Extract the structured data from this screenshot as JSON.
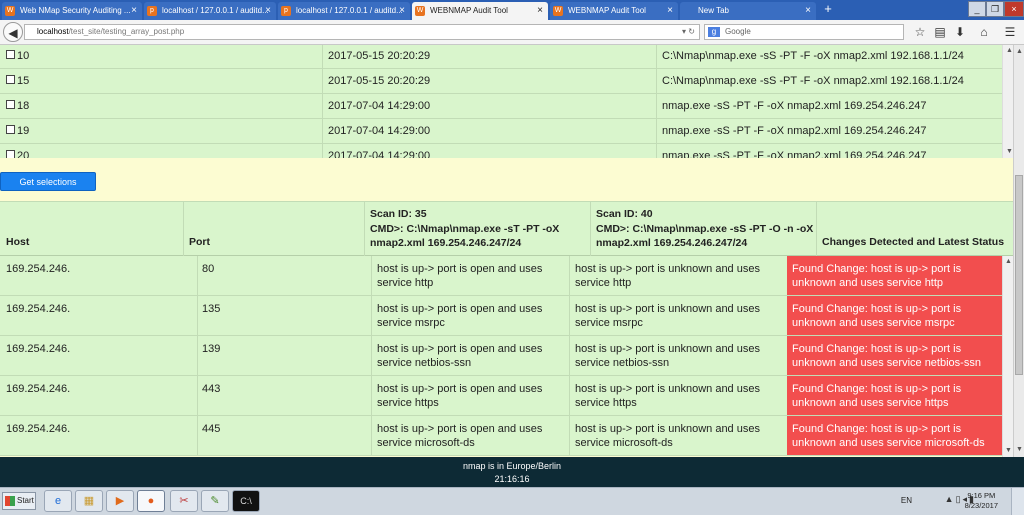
{
  "browser": {
    "tabs": [
      {
        "title": "Web NMap Security Auditing ...",
        "active": false
      },
      {
        "title": "localhost / 127.0.0.1 / auditd...",
        "active": false
      },
      {
        "title": "localhost / 127.0.0.1 / auditd...",
        "active": false
      },
      {
        "title": "WEBNMAP Audit Tool",
        "active": true
      },
      {
        "title": "WEBNMAP Audit Tool",
        "active": false
      },
      {
        "title": "New Tab",
        "active": false
      }
    ],
    "url_host": "localhost",
    "url_path": "/test_site/testing_array_post.php",
    "search_placeholder": "Google"
  },
  "scan_list": {
    "rows": [
      {
        "id": "10",
        "date": "2017-05-15 20:20:29",
        "cmd": "C:\\Nmap\\nmap.exe -sS -PT -F -oX nmap2.xml 192.168.1.1/24"
      },
      {
        "id": "15",
        "date": "2017-05-15 20:20:29",
        "cmd": "C:\\Nmap\\nmap.exe -sS -PT -F -oX nmap2.xml 192.168.1.1/24"
      },
      {
        "id": "18",
        "date": "2017-07-04 14:29:00",
        "cmd": "nmap.exe -sS -PT -F -oX nmap2.xml 169.254.246.247"
      },
      {
        "id": "19",
        "date": "2017-07-04 14:29:00",
        "cmd": "nmap.exe -sS -PT -F -oX nmap2.xml 169.254.246.247"
      },
      {
        "id": "20",
        "date": "2017-07-04 14:29:00",
        "cmd": "nmap.exe -sS -PT -F -oX nmap2.xml 169.254.246.247"
      }
    ],
    "get_selections_label": "Get selections"
  },
  "comparison": {
    "headers": {
      "host": "Host",
      "port": "Port",
      "scan1_id": "Scan ID: 35",
      "scan1_cmd": "CMD>: C:\\Nmap\\nmap.exe -sT -PT -oX nmap2.xml 169.254.246.247/24",
      "scan2_id": "Scan ID: 40",
      "scan2_cmd": "CMD>: C:\\Nmap\\nmap.exe -sS -PT -O -n -oX nmap2.xml 169.254.246.247/24",
      "changes": "Changes Detected and Latest Status"
    },
    "rows": [
      {
        "host": "169.254.246.",
        "port": "80",
        "scan1": "host is up-> port is open and uses service http",
        "scan2": "host is up-> port is unknown and uses service http",
        "change": "Found Change: host is up-> port is unknown and uses service http"
      },
      {
        "host": "169.254.246.",
        "port": "135",
        "scan1": "host is up-> port is open and uses service msrpc",
        "scan2": "host is up-> port is unknown and uses service msrpc",
        "change": "Found Change: host is up-> port is unknown and uses service msrpc"
      },
      {
        "host": "169.254.246.",
        "port": "139",
        "scan1": "host is up-> port is open and uses service netbios-ssn",
        "scan2": "host is up-> port is unknown and uses service netbios-ssn",
        "change": "Found Change: host is up-> port is unknown and uses service netbios-ssn"
      },
      {
        "host": "169.254.246.",
        "port": "443",
        "scan1": "host is up-> port is open and uses service https",
        "scan2": "host is up-> port is unknown and uses service https",
        "change": "Found Change: host is up-> port is unknown and uses service https"
      },
      {
        "host": "169.254.246.",
        "port": "445",
        "scan1": "host is up-> port is open and uses service microsoft-ds",
        "scan2": "host is up-> port is unknown and uses service microsoft-ds",
        "change": "Found Change: host is up-> port is unknown and uses service microsoft-ds"
      }
    ]
  },
  "footer": {
    "location": "nmap is in Europe/Berlin",
    "time": "21:16:16"
  },
  "taskbar": {
    "start_label": "Start",
    "language": "EN",
    "clock_time": "9:16 PM",
    "clock_date": "8/23/2017"
  },
  "colors": {
    "row_green": "#d9f5cc",
    "change_red": "#f24e4e",
    "page_yellow": "#fcfcd2",
    "button_blue": "#1a82f0",
    "footer_dark": "#0d2a35"
  }
}
